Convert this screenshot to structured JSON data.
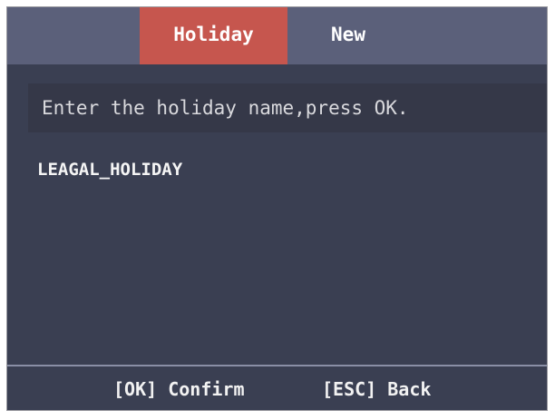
{
  "header": {
    "tabs": [
      {
        "label": "Holiday",
        "active": true
      },
      {
        "label": "New",
        "active": false
      }
    ]
  },
  "prompt": {
    "text": "Enter the holiday name,press OK."
  },
  "input": {
    "value": "LEAGAL_HOLIDAY"
  },
  "footer": {
    "confirm_label": "[OK] Confirm",
    "back_label": "[ESC] Back"
  },
  "colors": {
    "background": "#3a3f52",
    "header": "#5b607a",
    "active_tab": "#c6564e"
  }
}
